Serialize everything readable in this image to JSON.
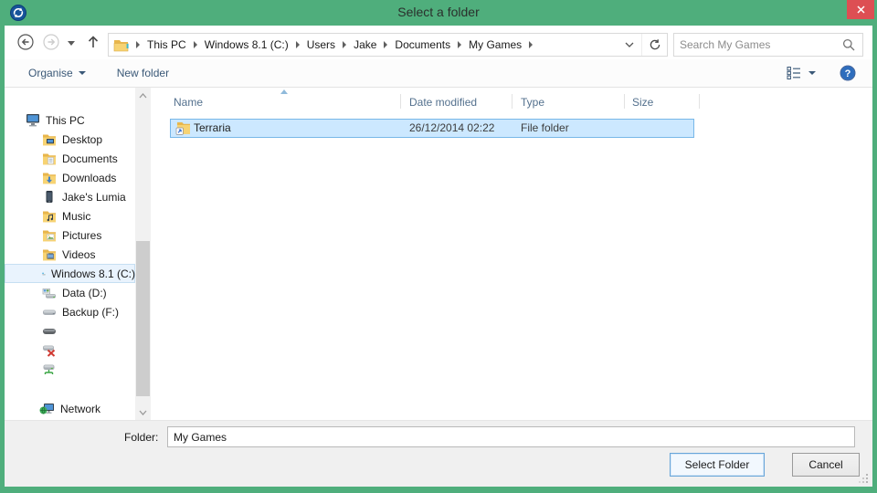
{
  "title_bar": {
    "title": "Select a folder"
  },
  "address_bar": {
    "breadcrumbs": [
      "This PC",
      "Windows 8.1 (C:)",
      "Users",
      "Jake",
      "Documents",
      "My Games"
    ]
  },
  "search": {
    "placeholder": "Search My Games"
  },
  "toolbar": {
    "organise_label": "Organise",
    "new_folder_label": "New folder"
  },
  "sidebar": {
    "items": [
      {
        "label": "This PC",
        "icon": "computer-icon"
      },
      {
        "label": "Desktop",
        "icon": "folder-desktop-icon"
      },
      {
        "label": "Documents",
        "icon": "folder-documents-icon"
      },
      {
        "label": "Downloads",
        "icon": "folder-downloads-icon"
      },
      {
        "label": "Jake's Lumia",
        "icon": "phone-icon"
      },
      {
        "label": "Music",
        "icon": "folder-music-icon"
      },
      {
        "label": "Pictures",
        "icon": "folder-pictures-icon"
      },
      {
        "label": "Videos",
        "icon": "folder-videos-icon"
      },
      {
        "label": "Windows 8.1 (C:)",
        "icon": "drive-windows-icon",
        "selected": true
      },
      {
        "label": "Data (D:)",
        "icon": "drive-data-icon"
      },
      {
        "label": "Backup (F:)",
        "icon": "drive-backup-icon"
      },
      {
        "label": "",
        "icon": "drive-plain-icon"
      },
      {
        "label": "",
        "icon": "drive-disconnected-icon"
      },
      {
        "label": "",
        "icon": "drive-network-icon"
      },
      {
        "label": "Network",
        "icon": "network-icon"
      }
    ]
  },
  "file_list": {
    "columns": [
      "Name",
      "Date modified",
      "Type",
      "Size"
    ],
    "sort": {
      "column": "Name",
      "direction": "ascending"
    },
    "rows": [
      {
        "name": "Terraria",
        "date_modified": "26/12/2014 02:22",
        "type": "File folder",
        "size": "",
        "icon": "folder-shortcut-icon",
        "selected": true
      }
    ]
  },
  "footer": {
    "folder_label": "Folder:",
    "folder_value": "My Games",
    "select_button": "Select Folder",
    "cancel_button": "Cancel"
  },
  "icons": {
    "app": "sync-arrows-circle",
    "close": "x-glyph",
    "back": "arrow-left-circle",
    "forward": "arrow-right-circle-disabled",
    "up": "arrow-up",
    "refresh": "refresh-arrow",
    "search": "magnifier",
    "view": "details-list",
    "help": "question-circle"
  },
  "colors": {
    "titlebar_green": "#4fae7c",
    "close_red": "#dd4f53",
    "selection_bg": "#cce8ff",
    "selection_border": "#77b7e8",
    "toolbar_text": "#3a5877",
    "header_text": "#54718e"
  }
}
